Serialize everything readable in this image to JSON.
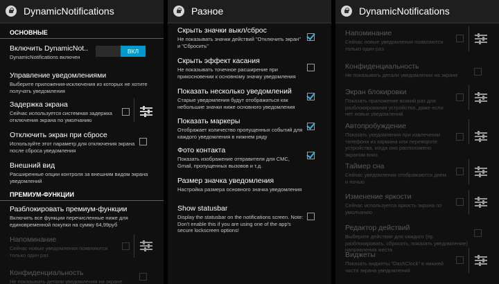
{
  "panel1": {
    "title": "DynamicNotifications",
    "section1": "ОСНОВНЫЕ",
    "enable_title": "Включить DynamicNot..",
    "enable_sub": "DynamicNotifications включен",
    "toggle_label": "ВКЛ",
    "manage_title": "Управление уведомлениями",
    "manage_sub": "Выберите приложения-исключения из которых не хотите получать уведомления",
    "delay_title": "Задержка экрана",
    "delay_sub": "Сейчас используется системная задержка отключения экрана по умолчанию",
    "off_title": "Отключить экран при сбросе",
    "off_sub": "Используйте этот параметр для отключения экрана после сброса уведомления",
    "look_title": "Внешний вид",
    "look_sub": "Расширенные опции контроля за внешним видом экрана уведомлений",
    "section2": "ПРЕМИУМ-ФУНКЦИИ",
    "unlock_title": "Разблокировать премиум-функции",
    "unlock_sub": "Включить все функции перечисленные ниже для единовременной покупки на сумму 64,99руб",
    "remind_title": "Напоминание",
    "remind_sub": "Сейчас новые уведомления появляются только один раз",
    "privacy_title": "Конфиденциальность",
    "privacy_sub": "Не показывать детали уведомления на экране"
  },
  "panel2": {
    "title": "Разное",
    "items": [
      {
        "title": "Скрыть значки выкл/сброс",
        "sub": "Не показывать значки действий \"Отключить экран\" и \"Сбросить\"",
        "checked": true
      },
      {
        "title": "Скрыть эффект касания",
        "sub": "Не показывать точечное расширение при прикосновении к основному значку уведомления",
        "checked": false
      },
      {
        "title": "Показать несколько уведомлений",
        "sub": "Старые уведомления будут отображаться как небольшие значки ниже основного уведомления",
        "checked": true
      },
      {
        "title": "Показать маркеры",
        "sub": "Отображает количество пропущенных событий для каждого уведомления в нижнем ряду",
        "checked": true
      },
      {
        "title": "Фото контакта",
        "sub": "Показать изображение отправителя для СМС, Gmail, пропущенных вызовов и т.д.",
        "checked": true
      },
      {
        "title": "Размер значка уведомления",
        "sub": "Настройка размера основного значка уведомления",
        "checked": false
      },
      {
        "title": "Show statusbar",
        "sub": "Display the statusbar on the notifications screen. Note: Don't enable this if you are using one of the app's secure lockscreen options!",
        "checked": false
      }
    ]
  },
  "panel3": {
    "title": "DynamicNotifications",
    "items": [
      {
        "title": "Напоминание",
        "sub": "Сейчас новые уведомления появляются только один раз"
      },
      {
        "title": "Конфиденциальность",
        "sub": "Не показывать детали уведомления на экране"
      },
      {
        "title": "Экран блокировки",
        "sub": "Показать приложение всякий раз для разблокирования устройства, даже если нет новых уведомлений"
      },
      {
        "title": "Автопробуждение",
        "sub": "Показать уведомления при извлечении телефона из кармана или перевороте устройства, когда оно расположено экраном вниз"
      },
      {
        "title": "Таймер сна",
        "sub": "Сейчас уведомления отображаются днем и ночью"
      },
      {
        "title": "Изменение яркости",
        "sub": "Сейчас используется яркость экрана по умолчанию"
      },
      {
        "title": "Редактор действий",
        "sub": "Выберите действие для каждого (пр. разблокировать, сбросить, показать уведомление) направления жеста"
      },
      {
        "title": "Виджеты",
        "sub": "Показать виджеты \"DashClock\" в нижней части экрана уведомлений"
      }
    ]
  }
}
